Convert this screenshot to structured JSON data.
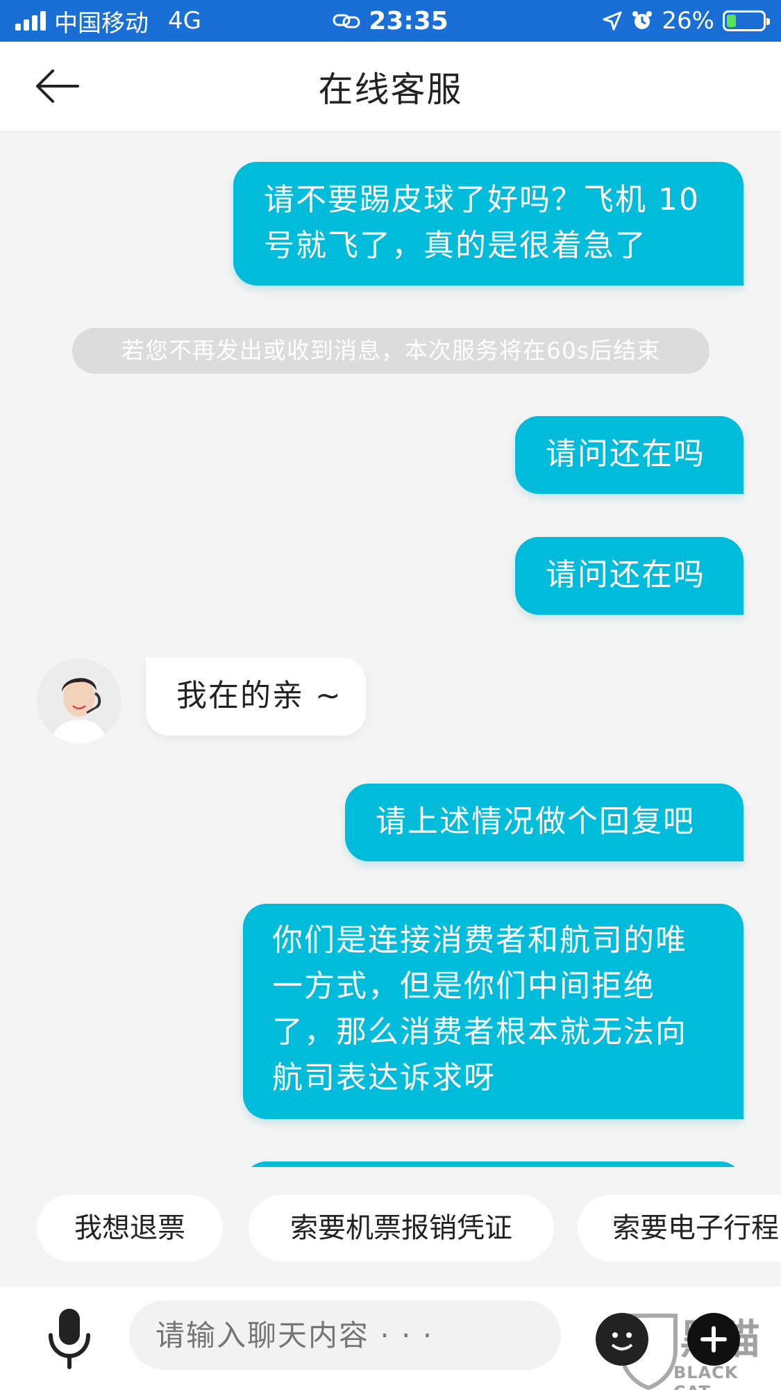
{
  "status_bar": {
    "carrier": "中国移动",
    "network": "4G",
    "time": "23:35",
    "battery": "26%",
    "battery_level": 0.26
  },
  "nav": {
    "title": "在线客服"
  },
  "messages": {
    "m1": {
      "line1": "请不要踢皮球了好吗？飞机 10",
      "line2": "号就飞了，真的是很着急了"
    },
    "notice": "若您不再发出或收到消息，本次服务将在60s后结束",
    "m2": "请问还在吗",
    "m3": "请问还在吗",
    "agent_reply": "我在的亲 ~",
    "m4": "请上述情况做个回复吧",
    "m5": {
      "line1": "你们是连接消费者和航司的唯",
      "line2": "一方式，但是你们中间拒绝",
      "line3": "了，那么消费者根本就无法向",
      "line4": "航司表达诉求呀"
    }
  },
  "quick_replies": [
    "我想退票",
    "索要机票报销凭证",
    "索要电子行程"
  ],
  "input": {
    "placeholder": "请输入聊天内容 · · ·"
  },
  "watermark": {
    "text": "BLACK CAT"
  },
  "colors": {
    "status_bar_bg": "#1a6fd6",
    "user_bubble": "#00bcdb",
    "agent_bubble": "#ffffff",
    "background": "#f4f4f4"
  },
  "icons": [
    "back-arrow-icon",
    "mic-icon",
    "emoji-icon",
    "plus-icon",
    "location-icon",
    "alarm-icon",
    "battery-icon",
    "signal-icon",
    "link-icon"
  ]
}
